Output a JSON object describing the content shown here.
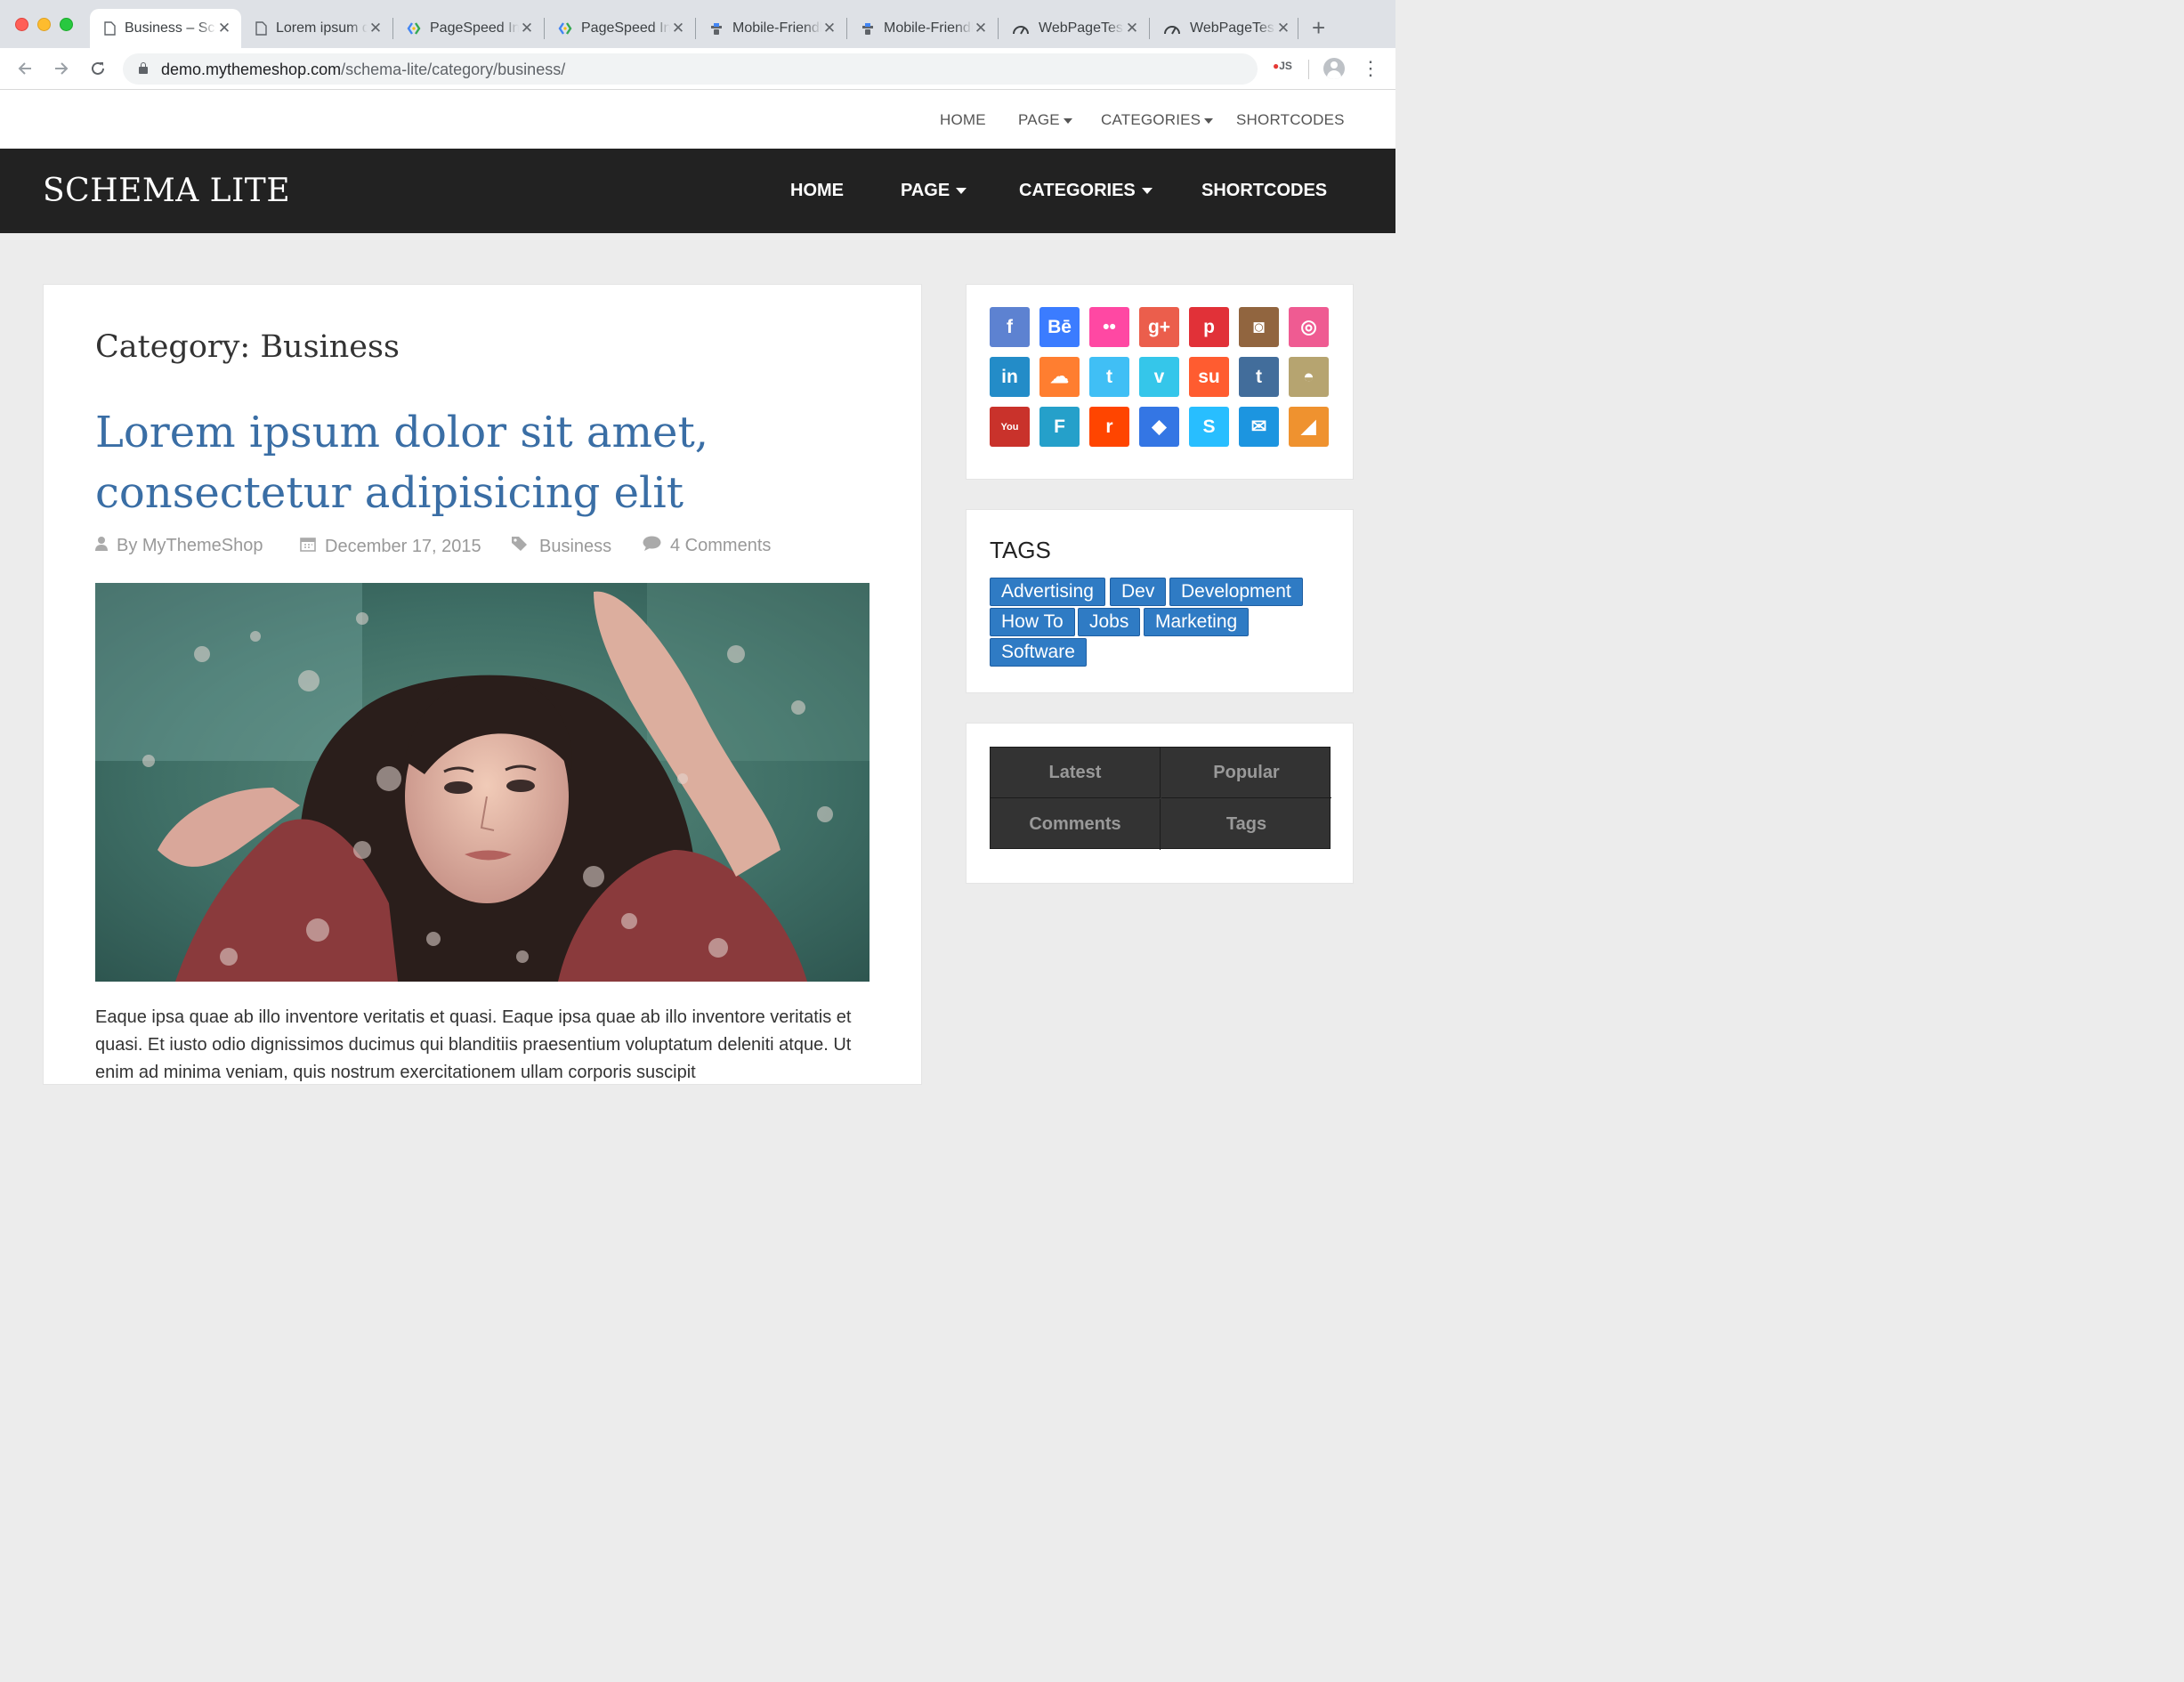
{
  "browser": {
    "tabs": [
      {
        "title": "Business – Schema Lite",
        "active": true,
        "icon": "page-icon"
      },
      {
        "title": "Lorem ipsum dolor sit amet",
        "icon": "page-icon"
      },
      {
        "title": "PageSpeed Insights",
        "icon": "pagespeed-icon"
      },
      {
        "title": "PageSpeed Insights",
        "icon": "pagespeed-icon"
      },
      {
        "title": "Mobile-Friendly Test",
        "icon": "mobile-friendly-icon"
      },
      {
        "title": "Mobile-Friendly Test",
        "icon": "mobile-friendly-icon"
      },
      {
        "title": "WebPageTest",
        "icon": "gauge-icon"
      },
      {
        "title": "WebPageTest",
        "icon": "gauge-icon"
      }
    ],
    "url_host": "demo.mythemeshop.com",
    "url_path": "/schema-lite/category/business/",
    "extension_label": "JS"
  },
  "topnav": {
    "items": [
      "HOME",
      "PAGE",
      "CATEGORIES",
      "SHORTCODES"
    ]
  },
  "header": {
    "logo": "SCHEMA LITE",
    "nav": [
      "HOME",
      "PAGE",
      "CATEGORIES",
      "SHORTCODES"
    ]
  },
  "content": {
    "category_title": "Category: Business",
    "post_title": "Lorem ipsum dolor sit amet, consectetur adipisicing elit",
    "meta": {
      "author": "By MyThemeShop",
      "date": "December 17, 2015",
      "category": "Business",
      "comments": "4 Comments"
    },
    "excerpt": "Eaque ipsa quae ab illo inventore veritatis et quasi. Eaque ipsa quae ab illo inventore veritatis et quasi. Et iusto odio dignissimos ducimus qui blanditiis praesentium voluptatum deleniti atque. Ut enim ad minima veniam, quis nostrum exercitationem ullam corporis suscipit"
  },
  "sidebar": {
    "social": [
      {
        "name": "facebook-icon",
        "glyph": "f",
        "color": "#5d82d1"
      },
      {
        "name": "behance-icon",
        "glyph": "Bē",
        "color": "#3b7cff"
      },
      {
        "name": "flickr-icon",
        "glyph": "••",
        "color": "#ff48a3"
      },
      {
        "name": "google-plus-icon",
        "glyph": "g+",
        "color": "#eb5e4c"
      },
      {
        "name": "pinterest-icon",
        "glyph": "p",
        "color": "#e13138"
      },
      {
        "name": "instagram-icon",
        "glyph": "◙",
        "color": "#91653f"
      },
      {
        "name": "dribbble-icon",
        "glyph": "◎",
        "color": "#ef5b92"
      },
      {
        "name": "linkedin-icon",
        "glyph": "in",
        "color": "#238cc8"
      },
      {
        "name": "soundcloud-icon",
        "glyph": "☁",
        "color": "#ff7e30"
      },
      {
        "name": "twitter-icon",
        "glyph": "t",
        "color": "#40bff5"
      },
      {
        "name": "vimeo-icon",
        "glyph": "v",
        "color": "#35c6ea"
      },
      {
        "name": "stumbleupon-icon",
        "glyph": "su",
        "color": "#ff5c30"
      },
      {
        "name": "tumblr-icon",
        "glyph": "t",
        "color": "#426d9b"
      },
      {
        "name": "github-icon",
        "glyph": "◓",
        "color": "#b6a470"
      },
      {
        "name": "youtube-icon",
        "glyph": "You",
        "color": "#c9322b"
      },
      {
        "name": "foursquare-icon",
        "glyph": "F",
        "color": "#25a0ca"
      },
      {
        "name": "reddit-icon",
        "glyph": "r",
        "color": "#ff4500"
      },
      {
        "name": "dropbox-icon",
        "glyph": "◆",
        "color": "#3476e4"
      },
      {
        "name": "skype-icon",
        "glyph": "S",
        "color": "#28beff"
      },
      {
        "name": "email-icon",
        "glyph": "✉",
        "color": "#1c95e0"
      },
      {
        "name": "rss-icon",
        "glyph": "◢",
        "color": "#ef922f"
      }
    ],
    "tags_title": "TAGS",
    "tags": [
      "Advertising",
      "Dev",
      "Development",
      "How To",
      "Jobs",
      "Marketing",
      "Software"
    ],
    "tabs": [
      "Latest",
      "Popular",
      "Comments",
      "Tags"
    ]
  }
}
